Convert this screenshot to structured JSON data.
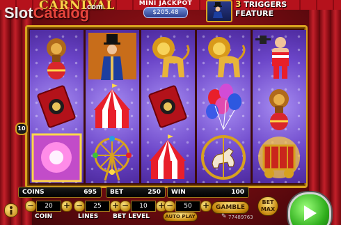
{
  "logo": {
    "title": "CARNIVAL"
  },
  "watermark": {
    "part1": "Slot",
    "part2": "Catalog",
    "dotcom": ".com"
  },
  "jackpot": {
    "label": "MINI JACKPOT",
    "value": "$205.48"
  },
  "triggers": {
    "number": "3",
    "word": "TRIGGERS",
    "line2": "FEATURE"
  },
  "payline_marker": "10",
  "reels": [
    [
      "lion-on-ball",
      "ringmaster",
      "ticket-card",
      "ticket-card"
    ],
    [
      "ringmaster",
      "circus-tent",
      "ferris-wheel"
    ],
    [
      "golden-lion",
      "ticket-card",
      "circus-tent"
    ],
    [
      "golden-lion",
      "balloons",
      "carousel-horse"
    ],
    [
      "strongman",
      "lion-on-ball",
      "circus-wagon"
    ]
  ],
  "grid": [
    [
      "lion-on-ball",
      "ringmaster",
      "golden-lion",
      "golden-lion",
      "strongman"
    ],
    [
      "ticket-card",
      "circus-tent",
      "ticket-card",
      "balloons",
      "lion-on-ball"
    ],
    [
      "scatter-light",
      "ferris-wheel",
      "circus-tent",
      "carousel-horse",
      "circus-wagon"
    ]
  ],
  "panel": {
    "coins_label": "COINS",
    "coins_value": "695",
    "bet_label": "BET",
    "bet_value": "250",
    "win_label": "WIN",
    "win_value": "100",
    "coin_label": "COIN",
    "coin_value": "20",
    "lines_label": "LINES",
    "lines_value": "25",
    "betlevel_label": "BET LEVEL",
    "betlevel_value": "10",
    "auto_value": "50",
    "auto_label": "AUTO PLAY",
    "gamble_label": "GAMBLE",
    "betmax_line1": "BET",
    "betmax_line2": "MAX",
    "credits_small": "77489763"
  },
  "colors": {
    "frame_gold": "#d7a11f",
    "reel_purple": "#6c46c9",
    "spin_green": "#2fae1c",
    "curtain_red": "#b5121c"
  }
}
